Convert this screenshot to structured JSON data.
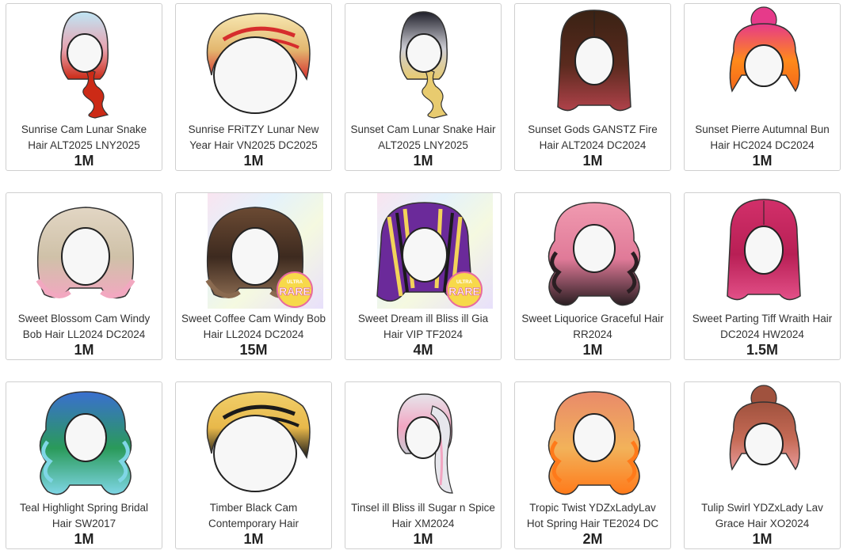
{
  "items": [
    {
      "name": "Sunrise Cam Lunar Snake Hair ALT2025 LNY2025",
      "price": "1M",
      "icon": "hair-long-braid-icon",
      "colors": [
        "#bfe6f5",
        "#e8a3b0",
        "#cc2a16"
      ],
      "bg": "none",
      "rare": false
    },
    {
      "name": "Sunrise FRiTZY Lunar New Year Hair VN2025 DC2025",
      "price": "1M",
      "icon": "hair-short-swept-icon",
      "colors": [
        "#f7e7b0",
        "#e3b870",
        "#d62d2d"
      ],
      "bg": "none",
      "rare": false
    },
    {
      "name": "Sunset Cam Lunar Snake Hair ALT2025 LNY2025",
      "price": "1M",
      "icon": "hair-long-braid-icon",
      "colors": [
        "#1f1f2a",
        "#cfcfd6",
        "#e8cb6f"
      ],
      "bg": "none",
      "rare": false
    },
    {
      "name": "Sunset Gods GANSTZ Fire Hair ALT2024 DC2024",
      "price": "1M",
      "icon": "hair-long-straight-icon",
      "colors": [
        "#3a2214",
        "#5a2a1e",
        "#b0424a"
      ],
      "bg": "none",
      "rare": false
    },
    {
      "name": "Sunset Pierre Autumnal Bun Hair HC2024 DC2024",
      "price": "1M",
      "icon": "hair-bun-icon",
      "colors": [
        "#e63a8a",
        "#ff8a1a",
        "#f2661a"
      ],
      "bg": "none",
      "rare": false
    },
    {
      "name": "Sweet Blossom Cam Windy Bob Hair LL2024 DC2024",
      "price": "1M",
      "icon": "hair-bob-icon",
      "colors": [
        "#e2d6c4",
        "#cfc1a8",
        "#f2a8c0"
      ],
      "bg": "none",
      "rare": false
    },
    {
      "name": "Sweet Coffee Cam Windy Bob Hair LL2024 DC2024",
      "price": "15M",
      "icon": "hair-bob-icon",
      "colors": [
        "#6b4a33",
        "#3d2a1f",
        "#8a6a50"
      ],
      "bg": "rainbow",
      "rare": true
    },
    {
      "name": "Sweet Dream ill Bliss ill Gia Hair VIP TF2024",
      "price": "4M",
      "icon": "hair-long-striped-icon",
      "colors": [
        "#6b2a9a",
        "#1a1a1a",
        "#f2d35a"
      ],
      "bg": "rainbow",
      "rare": true
    },
    {
      "name": "Sweet Liquorice Graceful Hair RR2024",
      "price": "1M",
      "icon": "hair-curly-long-icon",
      "colors": [
        "#f09ab0",
        "#e07a98",
        "#2a1e22"
      ],
      "bg": "none",
      "rare": false
    },
    {
      "name": "Sweet Parting Tiff Wraith Hair DC2024 HW2024",
      "price": "1.5M",
      "icon": "hair-long-straight-icon",
      "colors": [
        "#d2306a",
        "#b81f55",
        "#e35088"
      ],
      "bg": "none",
      "rare": false
    },
    {
      "name": "Teal Highlight Spring Bridal Hair SW2017",
      "price": "1M",
      "icon": "hair-curly-long-icon",
      "colors": [
        "#3a6fd0",
        "#2a9a5a",
        "#7fd6e6"
      ],
      "bg": "none",
      "rare": false
    },
    {
      "name": "Timber Black Cam Contemporary Hair",
      "price": "1M",
      "icon": "hair-short-swept-icon",
      "colors": [
        "#f0cf6a",
        "#e8b84a",
        "#1a1a1a"
      ],
      "bg": "none",
      "rare": false
    },
    {
      "name": "Tinsel ill Bliss ill Sugar n Spice Hair XM2024",
      "price": "1M",
      "icon": "hair-ponytail-icon",
      "colors": [
        "#e6e6ec",
        "#f2a6c2",
        "#c9c9d2"
      ],
      "bg": "none",
      "rare": false
    },
    {
      "name": "Tropic Twist YDZxLadyLav Hot Spring Hair TE2024 DC",
      "price": "2M",
      "icon": "hair-curly-long-icon",
      "colors": [
        "#e98a6a",
        "#f2b25a",
        "#ff7a1a"
      ],
      "bg": "none",
      "rare": false
    },
    {
      "name": "Tulip Swirl YDZxLady Lav Grace Hair XO2024",
      "price": "1M",
      "icon": "hair-bun-icon",
      "colors": [
        "#a0523e",
        "#c56a55",
        "#e89a9a"
      ],
      "bg": "none",
      "rare": false
    }
  ],
  "badge": {
    "top": "ULTRA",
    "main": "RARE"
  }
}
